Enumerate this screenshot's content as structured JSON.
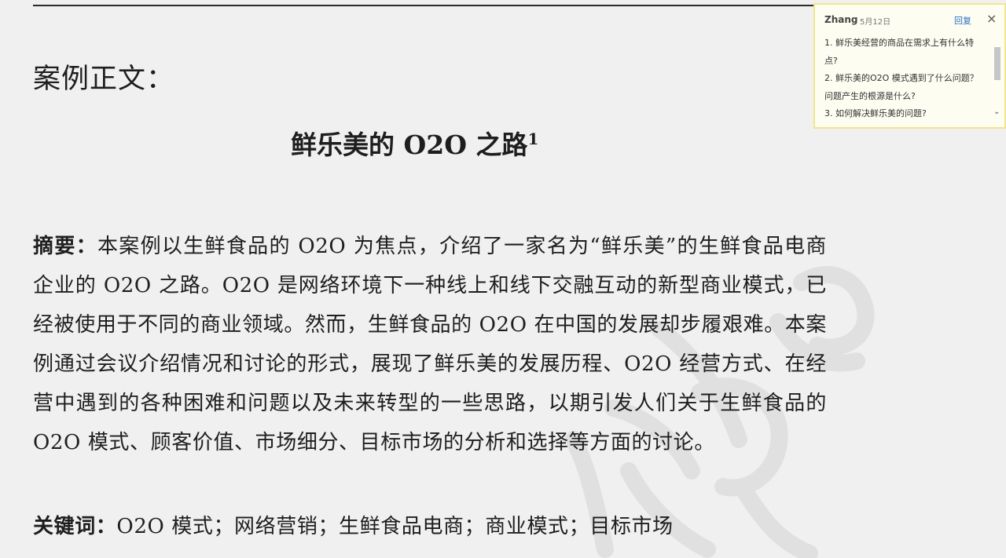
{
  "document": {
    "section_heading": "案例正文：",
    "title": "鲜乐美的 O2O 之路",
    "title_footnote": "1",
    "abstract_label": "摘要：",
    "abstract_text": "本案例以生鲜食品的 O2O 为焦点，介绍了一家名为“鲜乐美”的生鲜食品电商企业的 O2O 之路。O2O 是网络环境下一种线上和线下交融互动的新型商业模式，已经被使用于不同的商业领域。然而，生鲜食品的 O2O 在中国的发展却步履艰难。本案例通过会议介绍情况和讨论的形式，展现了鲜乐美的发展历程、O2O 经营方式、在经营中遇到的各种困难和问题以及未来转型的一些思路，以期引发人们关于生鲜食品的 O2O 模式、顾客价值、市场细分、目标市场的分析和选择等方面的讨论。",
    "keywords_label": "关键词：",
    "keywords_text": "O2O 模式；网络营销；生鲜食品电商；商业模式；目标市场"
  },
  "comment": {
    "author": "Zhang",
    "date": "5月12日",
    "reply_label": "回复",
    "close_label": "×",
    "items": [
      "1. 鲜乐美经营的商品在需求上有什么特点?",
      "2. 鲜乐美的O2O 模式遇到了什么问题？问题产生的根源是什么?",
      "3. 如何解决鲜乐美的问题?"
    ]
  },
  "colors": {
    "page_background": "#f0f0f1",
    "comment_border": "#f1e68c",
    "reply_link": "#2b6fc4"
  }
}
